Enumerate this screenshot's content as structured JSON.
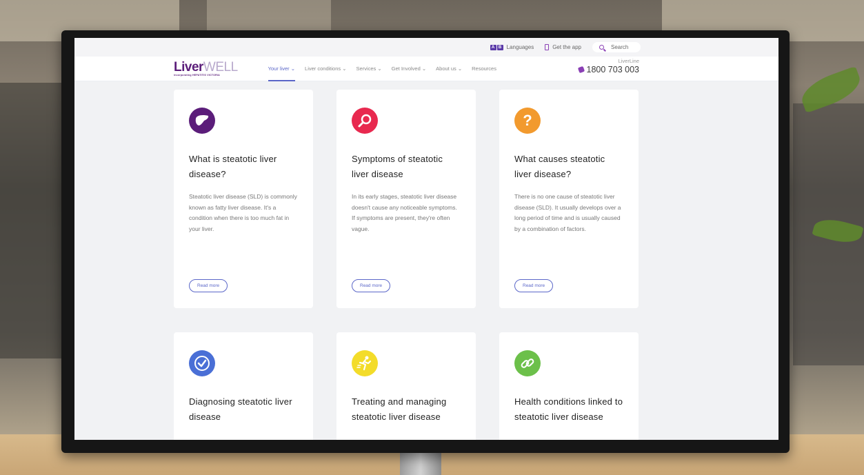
{
  "utility_bar": {
    "languages_label": "Languages",
    "lang_glyphs": [
      "A",
      "B"
    ],
    "app_label": "Get the app",
    "search_label": "Search"
  },
  "header": {
    "logo_liver": "Liver",
    "logo_well": "WELL",
    "logo_sub": "incorporating HEPATITIS VICTORIA",
    "menu": [
      {
        "label": "Your liver ⌄",
        "active": true
      },
      {
        "label": "Liver conditions ⌄",
        "active": false
      },
      {
        "label": "Services ⌄",
        "active": false
      },
      {
        "label": "Get Involved ⌄",
        "active": false
      },
      {
        "label": "About us ⌄",
        "active": false
      },
      {
        "label": "Resources",
        "active": false
      }
    ],
    "liverline_label": "LiverLine",
    "liverline_number": "1800 703 003"
  },
  "cards": [
    {
      "icon": "liver-icon",
      "color": "#5b1d7a",
      "title": "What is steatotic liver disease?",
      "body": "Steatotic liver disease (SLD) is commonly known as fatty liver disease. It's a condition when there is too much fat in your liver.",
      "button": "Read more"
    },
    {
      "icon": "magnifier-icon",
      "color": "#e8294f",
      "title": "Symptoms of steatotic liver disease",
      "body": "In its early stages, steatotic liver disease doesn't cause any noticeable symptoms. If symptoms are present, they're often vague.",
      "button": "Read more"
    },
    {
      "icon": "question-icon",
      "color": "#f29a2e",
      "title": "What causes steatotic liver disease?",
      "body": "There is no one cause of steatotic liver disease (SLD). It usually develops over a long period of time and is usually caused by a combination of factors.",
      "button": "Read more"
    },
    {
      "icon": "checkmark-icon",
      "color": "#4a6fd6",
      "title": "Diagnosing steatotic liver disease"
    },
    {
      "icon": "runner-icon",
      "color": "#f3dc2a",
      "title": "Treating and managing steatotic liver disease"
    },
    {
      "icon": "link-icon",
      "color": "#6cc04a",
      "title": "Health conditions linked to steatotic liver disease"
    }
  ]
}
